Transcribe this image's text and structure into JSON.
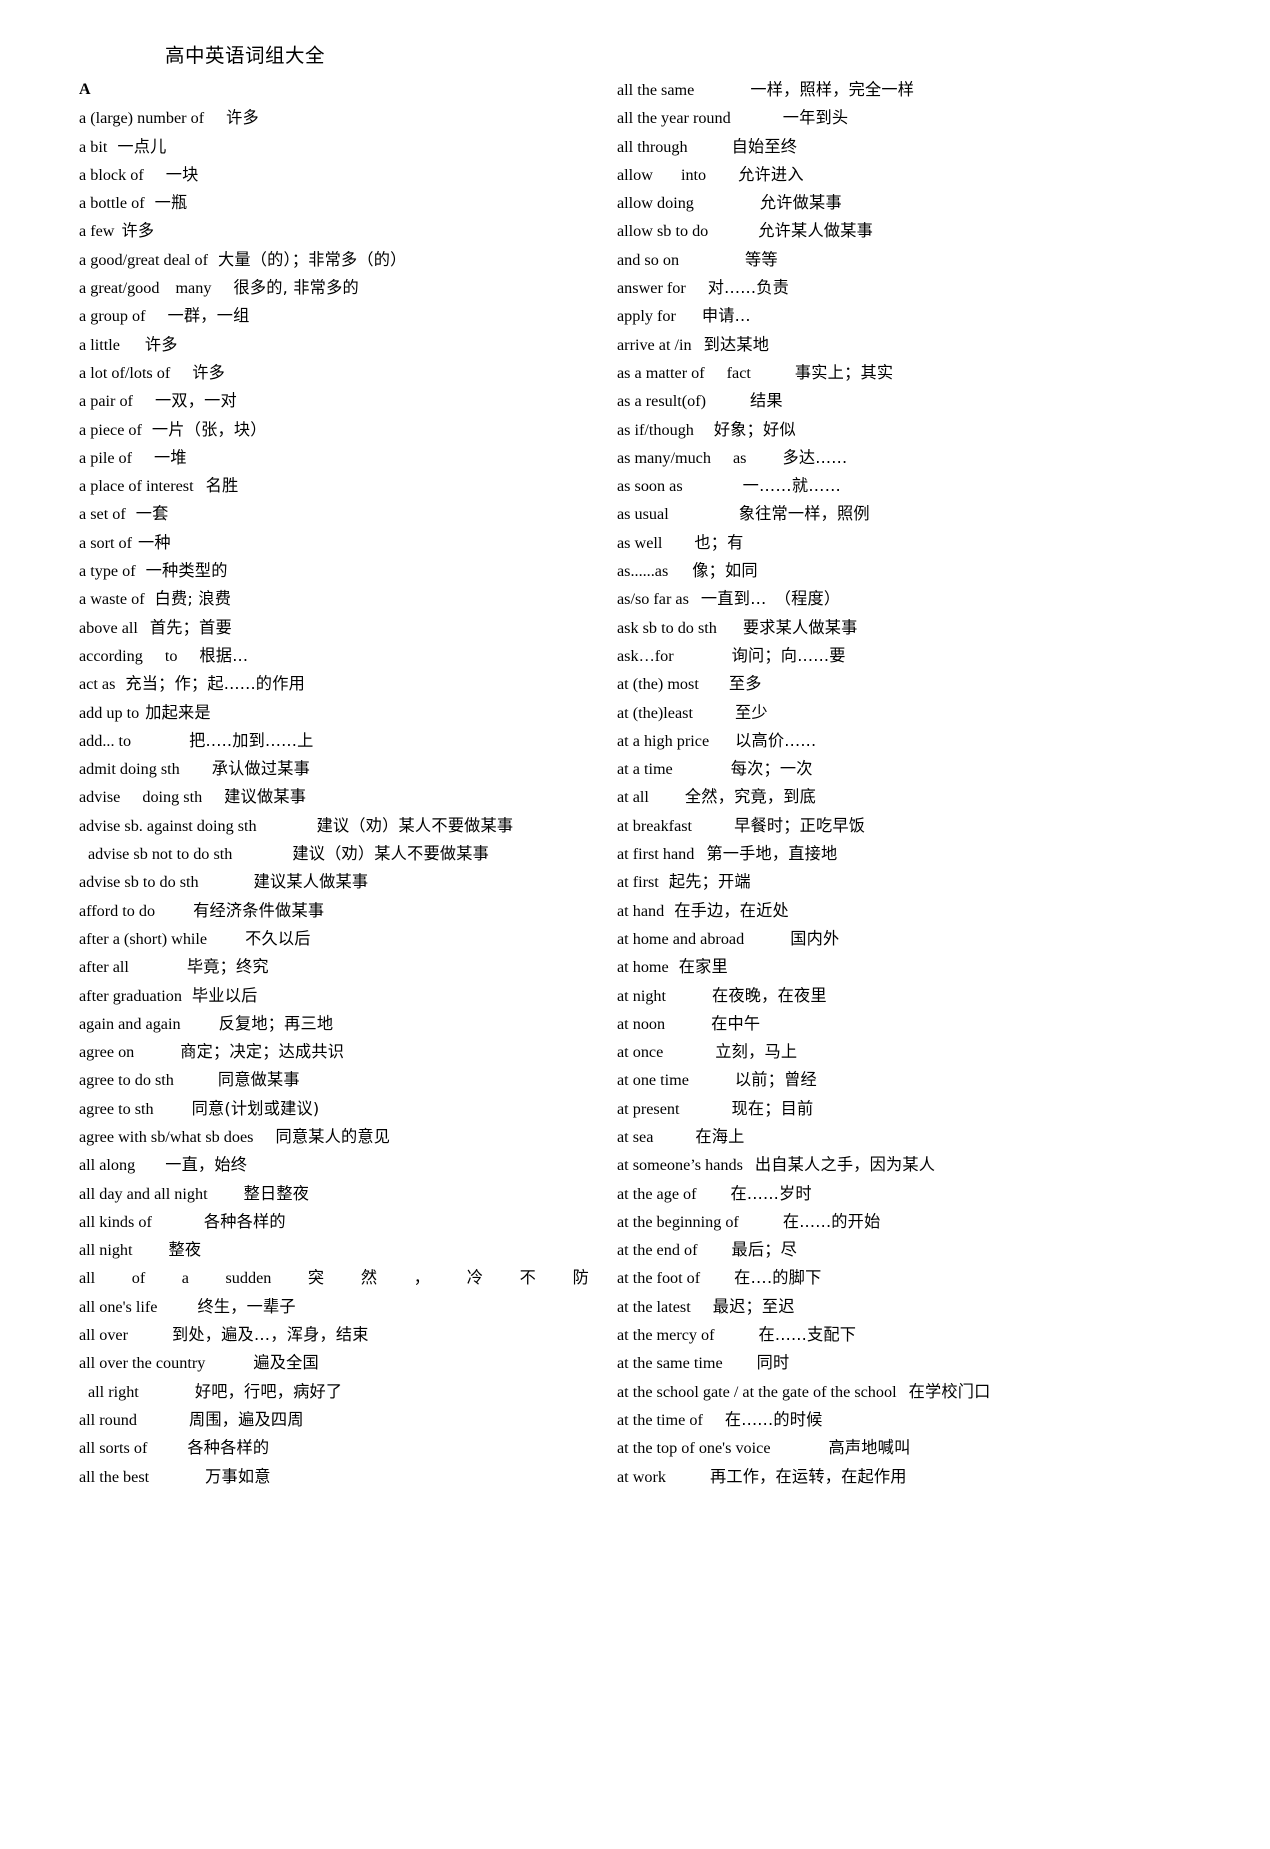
{
  "document": {
    "title": "高中英语词组大全",
    "section_letter": "A"
  },
  "left_column": [
    {
      "en": "a (large) number of",
      "gap": 22,
      "zh": "许多"
    },
    {
      "en": "a bit",
      "gap": 10,
      "zh": "一点儿"
    },
    {
      "en": "a block of",
      "gap": 22,
      "zh": "一块"
    },
    {
      "en": "a bottle of",
      "gap": 10,
      "zh": "一瓶"
    },
    {
      "en": "a few",
      "gap": 7,
      "zh": "许多"
    },
    {
      "en": "a good/great deal of",
      "gap": 10,
      "zh": "大量（的）；非常多（的）"
    },
    {
      "en": "a great/good",
      "gap": 16,
      "zh2": "many",
      "gap2": 22,
      "zh": "很多的, 非常多的"
    },
    {
      "en": "a group of",
      "gap": 22,
      "zh": "一群，一组"
    },
    {
      "en": "a little",
      "gap": 25,
      "zh": "许多"
    },
    {
      "en": "a lot of/lots of",
      "gap": 22,
      "zh": "许多"
    },
    {
      "en": "a pair of",
      "gap": 22,
      "zh": "一双，一对"
    },
    {
      "en": "a piece of",
      "gap": 10,
      "zh": "一片（张，块）"
    },
    {
      "en": "a pile of",
      "gap": 22,
      "zh": "一堆"
    },
    {
      "en": "a place of interest",
      "gap": 12,
      "zh": "名胜"
    },
    {
      "en": "a set of",
      "gap": 10,
      "zh": "一套"
    },
    {
      "en": "a sort of",
      "gap": 6,
      "zh": "一种"
    },
    {
      "en": "a type of",
      "gap": 10,
      "zh": "一种类型的"
    },
    {
      "en": "a waste of",
      "gap": 10,
      "zh": "白费; 浪费"
    },
    {
      "en": "above all",
      "gap": 12,
      "zh": "首先；首要"
    },
    {
      "en": "according",
      "gap": 22,
      "zh2": "to",
      "gap2": 22,
      "zh": "根据..."
    },
    {
      "en": "act as",
      "gap": 10,
      "zh": "充当；作；起......的作用"
    },
    {
      "en": "add up to",
      "gap": 6,
      "zh": "加起来是"
    },
    {
      "en": "add... to",
      "gap": 58,
      "zh": "把.....加到......上"
    },
    {
      "en": "admit doing sth",
      "gap": 32,
      "zh": "承认做过某事"
    },
    {
      "en": "advise",
      "gap": 22,
      "zh2": "doing sth",
      "gap2": 22,
      "zh": "建议做某事"
    },
    {
      "en": "advise sb. against doing sth",
      "gap": 60,
      "zh": "建议（劝）某人不要做某事"
    },
    {
      "en": "advise sb not to do sth",
      "gap": 60,
      "zh": "建议（劝）某人不要做某事",
      "indent": true
    },
    {
      "en": "advise sb to do sth",
      "gap": 55,
      "zh": "建议某人做某事"
    },
    {
      "en": "afford to do",
      "gap": 38,
      "zh": "有经济条件做某事"
    },
    {
      "en": "after a (short) while",
      "gap": 38,
      "zh": "不久以后"
    },
    {
      "en": "after all",
      "gap": 58,
      "zh": "毕竟；终究"
    },
    {
      "en": "after graduation",
      "gap": 10,
      "zh": "毕业以后"
    },
    {
      "en": "again and again",
      "gap": 38,
      "zh": "反复地；再三地"
    },
    {
      "en": "agree on",
      "gap": 46,
      "zh": "商定；决定；达成共识"
    },
    {
      "en": "agree to do sth",
      "gap": 44,
      "zh": "同意做某事"
    },
    {
      "en": "agree to sth",
      "gap": 38,
      "zh": "同意(计划或建议)"
    },
    {
      "en": "agree with sb/what sb does",
      "gap": 22,
      "zh": "同意某人的意见"
    },
    {
      "en": "all along",
      "gap": 30,
      "zh": "一直，始终"
    },
    {
      "en": "all day and all night",
      "gap": 36,
      "zh": "整日整夜"
    },
    {
      "en": "all kinds of",
      "gap": 52,
      "zh": "各种各样的"
    },
    {
      "en": "all night",
      "gap": 36,
      "zh": "整夜"
    },
    {
      "en": "all of a sudden",
      "zh": "突然，冷不防",
      "justified": true,
      "en_tokens": [
        "all",
        "of",
        "a",
        "sudden"
      ],
      "zh_tokens": [
        "突",
        "然",
        "，",
        "冷",
        "不",
        "防"
      ]
    },
    {
      "en": "all one's life",
      "gap": 40,
      "zh": "终生，一辈子"
    },
    {
      "en": "all over",
      "gap": 44,
      "zh": "到处，遍及…，浑身，结束"
    },
    {
      "en": "all over the country",
      "gap": 48,
      "zh": "遍及全国"
    },
    {
      "en": "all right",
      "gap": 56,
      "zh": "好吧，行吧，病好了",
      "indent": true
    },
    {
      "en": "all round",
      "gap": 52,
      "zh": "周围，遍及四周"
    },
    {
      "en": "all sorts of",
      "gap": 40,
      "zh": "各种各样的"
    },
    {
      "en": "all the best",
      "gap": 56,
      "zh": "万事如意"
    }
  ],
  "right_column": [
    {
      "en": "all the same",
      "gap": 56,
      "zh": "一样，照样，完全一样"
    },
    {
      "en": "all the year round",
      "gap": 52,
      "zh": "一年到头"
    },
    {
      "en": "all through",
      "gap": 44,
      "zh": "自始至终"
    },
    {
      "en": "allow",
      "gap": 28,
      "zh2": "into",
      "gap2": 32,
      "zh": "允许进入"
    },
    {
      "en": "allow doing",
      "gap": 66,
      "zh": "允许做某事"
    },
    {
      "en": "allow sb to do",
      "gap": 50,
      "zh": "允许某人做某事"
    },
    {
      "en": "and so on",
      "gap": 66,
      "zh": "等等"
    },
    {
      "en": "answer for",
      "gap": 22,
      "zh": "对......负责"
    },
    {
      "en": "apply for",
      "gap": 26,
      "zh": "申请..."
    },
    {
      "en": "arrive at /in",
      "gap": 12,
      "zh": "到达某地"
    },
    {
      "en": "as a matter of",
      "gap": 22,
      "zh2": "fact",
      "gap2": 44,
      "zh": "事实上；其实"
    },
    {
      "en": "as a result(of)",
      "gap": 44,
      "zh": "结果"
    },
    {
      "en": "as if/though",
      "gap": 20,
      "zh": "好象；好似"
    },
    {
      "en": "as many/much",
      "gap": 22,
      "zh2": "as",
      "gap2": 36,
      "zh": "多达......"
    },
    {
      "en": "as soon as",
      "gap": 60,
      "zh": "一……就……"
    },
    {
      "en": "as usual",
      "gap": 70,
      "zh": "象往常一样，照例"
    },
    {
      "en": "as well",
      "gap": 32,
      "zh": "也；有"
    },
    {
      "en": "as......as",
      "gap": 24,
      "zh": "像；如同"
    },
    {
      "en": "as/so far as",
      "gap": 12,
      "zh": "一直到…　（程度）"
    },
    {
      "en": "ask sb to do sth",
      "gap": 26,
      "zh": "要求某人做某事"
    },
    {
      "en": "ask…for",
      "gap": 58,
      "zh": "询问；向......要"
    },
    {
      "en": "at (the) most",
      "gap": 30,
      "zh": "至多"
    },
    {
      "en": "at (the)least",
      "gap": 42,
      "zh": "至少"
    },
    {
      "en": "at a high price",
      "gap": 26,
      "zh": "以高价......"
    },
    {
      "en": "at a time",
      "gap": 58,
      "zh": "每次；一次"
    },
    {
      "en": "at all",
      "gap": 36,
      "zh": "全然，究竟，到底"
    },
    {
      "en": "at breakfast",
      "gap": 42,
      "zh": "早餐时；正吃早饭"
    },
    {
      "en": "at first hand",
      "gap": 12,
      "zh": "第一手地，直接地"
    },
    {
      "en": "at first",
      "gap": 10,
      "zh": "起先；开端"
    },
    {
      "en": "at hand",
      "gap": 10,
      "zh": "在手边，在近处"
    },
    {
      "en": "at home and abroad",
      "gap": 46,
      "zh": "国内外"
    },
    {
      "en": "at home",
      "gap": 10,
      "zh": "在家里"
    },
    {
      "en": "at night",
      "gap": 46,
      "zh": "在夜晚，在夜里"
    },
    {
      "en": "at noon",
      "gap": 46,
      "zh": "在中午"
    },
    {
      "en": "at once",
      "gap": 52,
      "zh": "立刻，马上"
    },
    {
      "en": "at one time",
      "gap": 46,
      "zh": "以前；曾经"
    },
    {
      "en": "at present",
      "gap": 52,
      "zh": "现在；目前"
    },
    {
      "en": "at sea",
      "gap": 42,
      "zh": "在海上"
    },
    {
      "en": "at someone’s hands",
      "gap": 12,
      "zh": "出自某人之手，因为某人"
    },
    {
      "en": "at the age of",
      "gap": 34,
      "zh": "在......岁时"
    },
    {
      "en": "at the beginning of",
      "gap": 44,
      "zh": "在......的开始"
    },
    {
      "en": "at the end of",
      "gap": 34,
      "zh": "最后；尽"
    },
    {
      "en": "at the foot of",
      "gap": 34,
      "zh": "在….的脚下"
    },
    {
      "en": "at the latest",
      "gap": 22,
      "zh": "最迟；至迟"
    },
    {
      "en": "at the mercy of",
      "gap": 44,
      "zh": "在......支配下"
    },
    {
      "en": "at the same time",
      "gap": 34,
      "zh": "同时"
    },
    {
      "en": "at the school gate / at the gate of the school",
      "gap": 12,
      "zh": "在学校门口"
    },
    {
      "en": "at the time of",
      "gap": 22,
      "zh": "在......的时候"
    },
    {
      "en": "at the top of one's voice",
      "gap": 58,
      "zh": "高声地喊叫"
    },
    {
      "en": "at work",
      "gap": 44,
      "zh": "再工作，在运转，在起作用"
    }
  ]
}
